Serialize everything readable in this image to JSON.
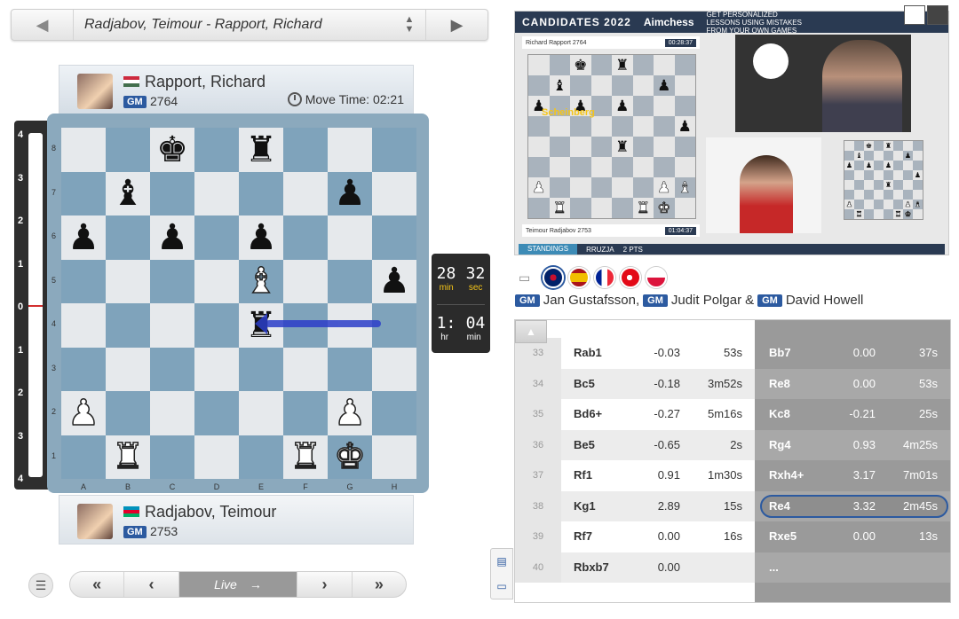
{
  "game_selector": {
    "title": "Radjabov, Teimour - Rapport, Richard",
    "prev_icon": "caret-left-icon",
    "next_icon": "caret-right-icon"
  },
  "player_top": {
    "name": "Rapport, Richard",
    "title": "GM",
    "rating": "2764",
    "flag": "hungary",
    "move_time_label": "Move Time: 02:21"
  },
  "player_bottom": {
    "name": "Radjabov, Teimour",
    "title": "GM",
    "rating": "2753",
    "flag": "azerbaijan"
  },
  "eval_bar": {
    "ticks": [
      "4",
      "3",
      "2",
      "1",
      "0",
      "1",
      "2",
      "3",
      "4"
    ],
    "black_share": 0.0
  },
  "board": {
    "files": [
      "A",
      "B",
      "C",
      "D",
      "E",
      "F",
      "G",
      "H"
    ],
    "ranks": [
      "8",
      "7",
      "6",
      "5",
      "4",
      "3",
      "2",
      "1"
    ],
    "position": [
      [
        "",
        "",
        "bk",
        "",
        "br",
        "",
        "",
        ""
      ],
      [
        "",
        "bb",
        "",
        "",
        "",
        "",
        "bp",
        ""
      ],
      [
        "bp",
        "",
        "bp",
        "",
        "bp",
        "",
        "",
        ""
      ],
      [
        "",
        "",
        "",
        "",
        "wb",
        "",
        "",
        "bp"
      ],
      [
        "",
        "",
        "",
        "",
        "br",
        "",
        "",
        ""
      ],
      [
        "",
        "",
        "",
        "",
        "",
        "",
        "",
        ""
      ],
      [
        "wp",
        "",
        "",
        "",
        "",
        "",
        "wp",
        ""
      ],
      [
        "",
        "wr",
        "",
        "",
        "",
        "wr",
        "wk",
        ""
      ]
    ],
    "last_move_arrow": {
      "from": "h4",
      "to": "e4"
    }
  },
  "clocks": {
    "game_clock": {
      "min": "28",
      "sec": "32",
      "min_label": "min",
      "sec_label": "sec"
    },
    "elapsed": {
      "hr": "1:",
      "min": "04",
      "hr_label": "hr",
      "min_label": "min"
    }
  },
  "nav": {
    "first_icon": "double-chevron-left-icon",
    "prev_icon": "chevron-left-icon",
    "live_label": "Live",
    "next_icon": "chevron-right-icon",
    "last_icon": "double-chevron-right-icon",
    "menu_icon": "menu-icon"
  },
  "video": {
    "event": "CANDIDATES 2022",
    "sponsor": "Aimchess",
    "promo": "GET PERSONALIZED LESSONS USING MISTAKES FROM YOUR OWN GAMES",
    "board_top_player": "Richard Rapport 2764",
    "board_top_clock": "00:28:37",
    "board_bottom_player": "Teimour Radjabov 2753",
    "board_bottom_clock": "01:04:37",
    "cam_label": "Scheinberg",
    "standings_tab": "STANDINGS",
    "standings_entry": "RRUZJA",
    "standings_points": "2 PTS",
    "position": [
      [
        "",
        "",
        "bk",
        "",
        "br",
        "",
        "",
        ""
      ],
      [
        "",
        "bb",
        "",
        "",
        "",
        "",
        "bp",
        ""
      ],
      [
        "bp",
        "",
        "bp",
        "",
        "bp",
        "",
        "",
        ""
      ],
      [
        "",
        "",
        "",
        "",
        "",
        "",
        "",
        "bp"
      ],
      [
        "",
        "",
        "",
        "",
        "br",
        "",
        "",
        ""
      ],
      [
        "",
        "",
        "",
        "",
        "",
        "",
        "",
        ""
      ],
      [
        "wp",
        "",
        "",
        "",
        "",
        "",
        "wp",
        "wb"
      ],
      [
        "",
        "wr",
        "",
        "",
        "",
        "wr",
        "wk",
        ""
      ]
    ]
  },
  "commentary": {
    "flags": [
      "united-kingdom",
      "spain",
      "france",
      "turkey",
      "poland"
    ],
    "selected_flag": "united-kingdom",
    "commentators": [
      {
        "title": "GM",
        "name": "Jan Gustafsson,",
        "sep": ""
      },
      {
        "title": "GM",
        "name": "Judit Polgar",
        "sep": "&"
      },
      {
        "title": "GM",
        "name": "David Howell",
        "sep": ""
      }
    ]
  },
  "moves": {
    "rows": [
      {
        "num": "33",
        "white": "Rab1",
        "w_eval": "-0.03",
        "w_time": "53s",
        "black": "Bb7",
        "b_eval": "0.00",
        "b_time": "37s"
      },
      {
        "num": "34",
        "white": "Bc5",
        "w_eval": "-0.18",
        "w_time": "3m52s",
        "black": "Re8",
        "b_eval": "0.00",
        "b_time": "53s"
      },
      {
        "num": "35",
        "white": "Bd6+",
        "w_eval": "-0.27",
        "w_time": "5m16s",
        "black": "Kc8",
        "b_eval": "-0.21",
        "b_time": "25s"
      },
      {
        "num": "36",
        "white": "Be5",
        "w_eval": "-0.65",
        "w_time": "2s",
        "black": "Rg4",
        "b_eval": "0.93",
        "b_time": "4m25s"
      },
      {
        "num": "37",
        "white": "Rf1",
        "w_eval": "0.91",
        "w_time": "1m30s",
        "black": "Rxh4+",
        "b_eval": "3.17",
        "b_time": "7m01s"
      },
      {
        "num": "38",
        "white": "Kg1",
        "w_eval": "2.89",
        "w_time": "15s",
        "black": "Re4",
        "b_eval": "3.32",
        "b_time": "2m45s"
      },
      {
        "num": "39",
        "white": "Rf7",
        "w_eval": "0.00",
        "w_time": "16s",
        "black": "Rxe5",
        "b_eval": "0.00",
        "b_time": "13s"
      },
      {
        "num": "40",
        "white": "Rbxb7",
        "w_eval": "0.00",
        "w_time": "",
        "black": "...",
        "b_eval": "",
        "b_time": ""
      }
    ],
    "current_index": 5
  },
  "colors": {
    "accent": "#2c5aa0",
    "board_light": "#e6e9ec",
    "board_dark": "#7fa3bb",
    "arrow": "#2c3ec9"
  }
}
